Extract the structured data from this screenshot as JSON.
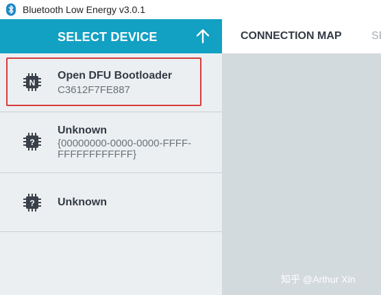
{
  "window": {
    "title": "Bluetooth Low Energy v3.0.1"
  },
  "sidebar": {
    "header_label": "SELECT DEVICE",
    "devices": [
      {
        "name": "Open DFU Bootloader",
        "address": "C3612F7FE887",
        "chip_glyph": "N",
        "selected": true
      },
      {
        "name": "Unknown",
        "address": "{00000000-0000-0000-FFFF-FFFFFFFFFFFF}",
        "chip_glyph": "?"
      },
      {
        "name": "Unknown",
        "chip_glyph": "?"
      }
    ]
  },
  "nav": {
    "tabs": [
      {
        "label": "CONNECTION MAP"
      },
      {
        "label": "SE"
      }
    ]
  },
  "watermark": "知乎 @Arthur Xin",
  "colors": {
    "header_bg": "#12a0c3",
    "sidebar_bg": "#eceff1",
    "main_bg": "#d3dade",
    "highlight": "#d63a3a"
  }
}
